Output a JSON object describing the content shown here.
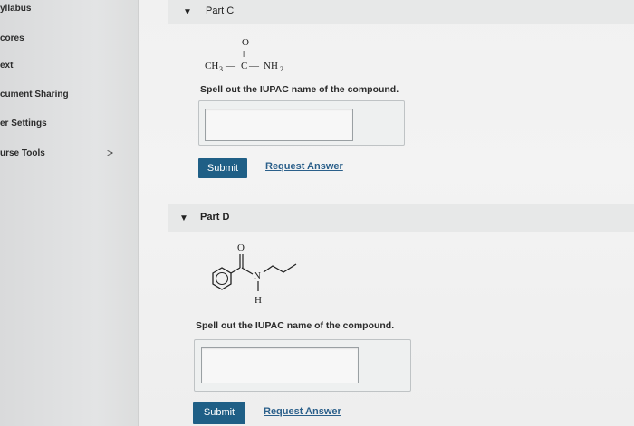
{
  "sidebar": {
    "items": [
      {
        "label": "yllabus"
      },
      {
        "label": "cores"
      },
      {
        "label": "ext"
      },
      {
        "label": "cument Sharing"
      },
      {
        "label": "er Settings"
      },
      {
        "label": "urse Tools"
      }
    ],
    "chevron": ">"
  },
  "partC": {
    "title": "Part C",
    "formula": {
      "o": "O",
      "bond": "‖",
      "ch3": "CH",
      "ch3_sub": "3",
      "dash1": "—",
      "c": "C",
      "dash2": "—",
      "nh2": "NH",
      "nh2_sub": "2"
    },
    "prompt": "Spell out the IUPAC name of the compound.",
    "answer_value": "",
    "submit_label": "Submit",
    "request_label": "Request Answer"
  },
  "partD": {
    "title": "Part D",
    "structure_labels": {
      "o": "O",
      "n": "N",
      "h": "H"
    },
    "prompt": "Spell out the IUPAC name of the compound.",
    "answer_value": "",
    "submit_label": "Submit",
    "request_label": "Request Answer"
  },
  "colors": {
    "button": "#1f5f86",
    "link": "#2a5f8a"
  }
}
